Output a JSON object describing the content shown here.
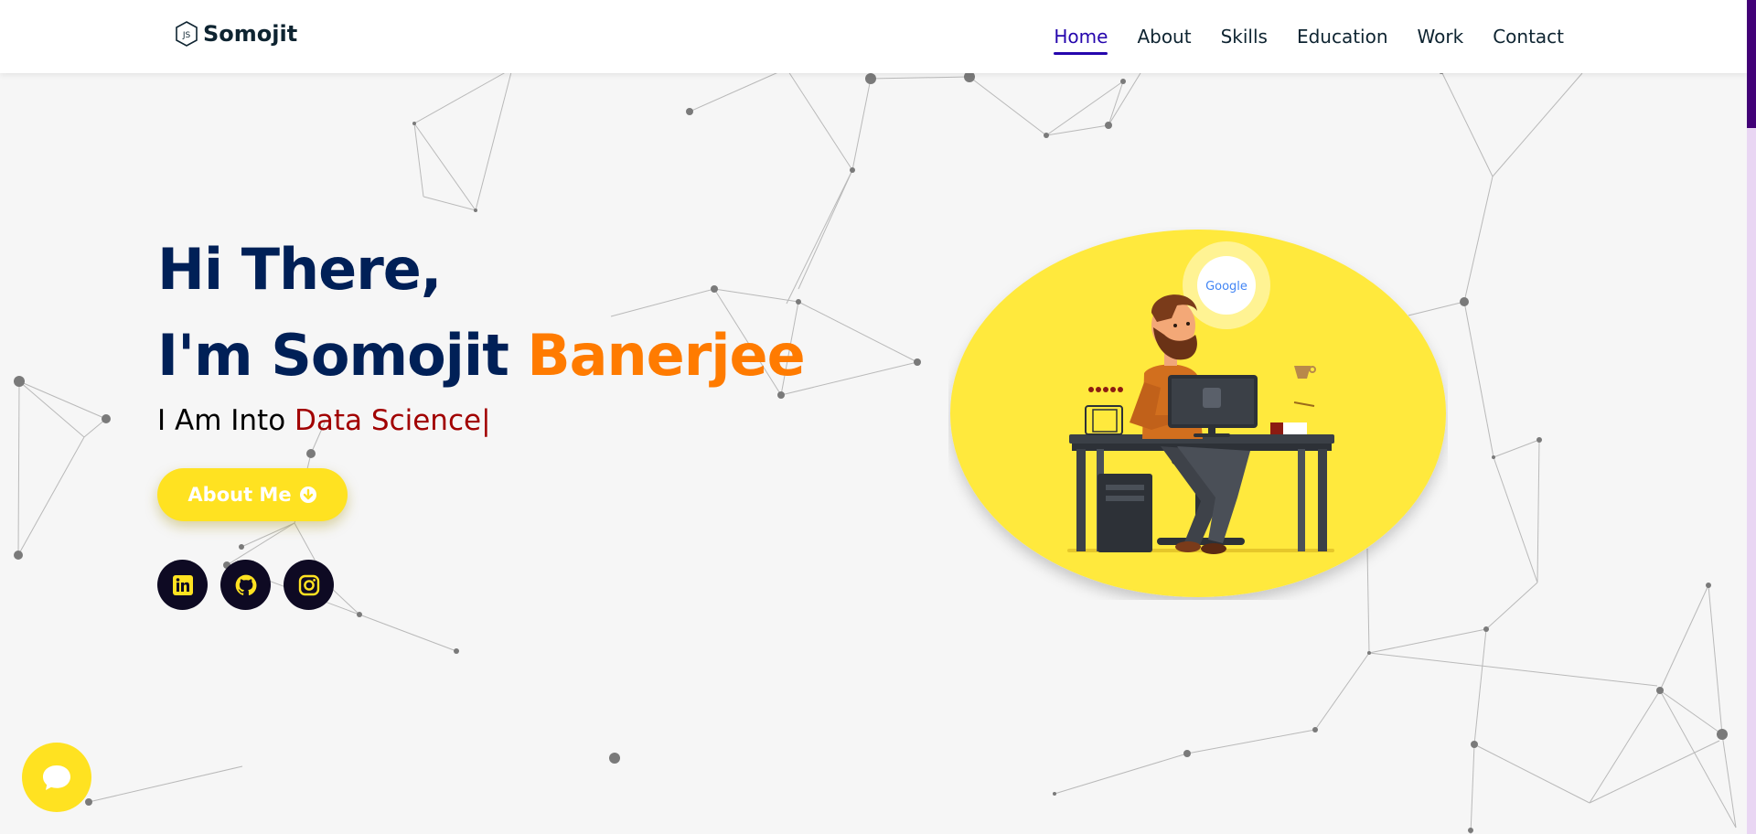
{
  "brand": {
    "name": "Somojit"
  },
  "nav": {
    "items": [
      {
        "label": "Home",
        "active": true
      },
      {
        "label": "About",
        "active": false
      },
      {
        "label": "Skills",
        "active": false
      },
      {
        "label": "Education",
        "active": false
      },
      {
        "label": "Work",
        "active": false
      },
      {
        "label": "Contact",
        "active": false
      }
    ]
  },
  "hero": {
    "greeting": "Hi There,",
    "intro_prefix": "I'm Somojit",
    "intro_accent": "Banerjee",
    "into_prefix": "I Am Into",
    "into_typed": "Data Science",
    "caret": "|",
    "about_button": "About Me",
    "illustration_badge": "Google"
  },
  "socials": [
    {
      "name": "linkedin-icon"
    },
    {
      "name": "github-icon"
    },
    {
      "name": "instagram-icon"
    }
  ],
  "colors": {
    "navy": "#002057",
    "accent_orange": "#ff7b00",
    "typed_red": "#a10000",
    "yellow": "#ffe221",
    "nav_active": "#2506ad",
    "social_bg": "#0e0a23",
    "scroll_thumb": "#420177"
  }
}
